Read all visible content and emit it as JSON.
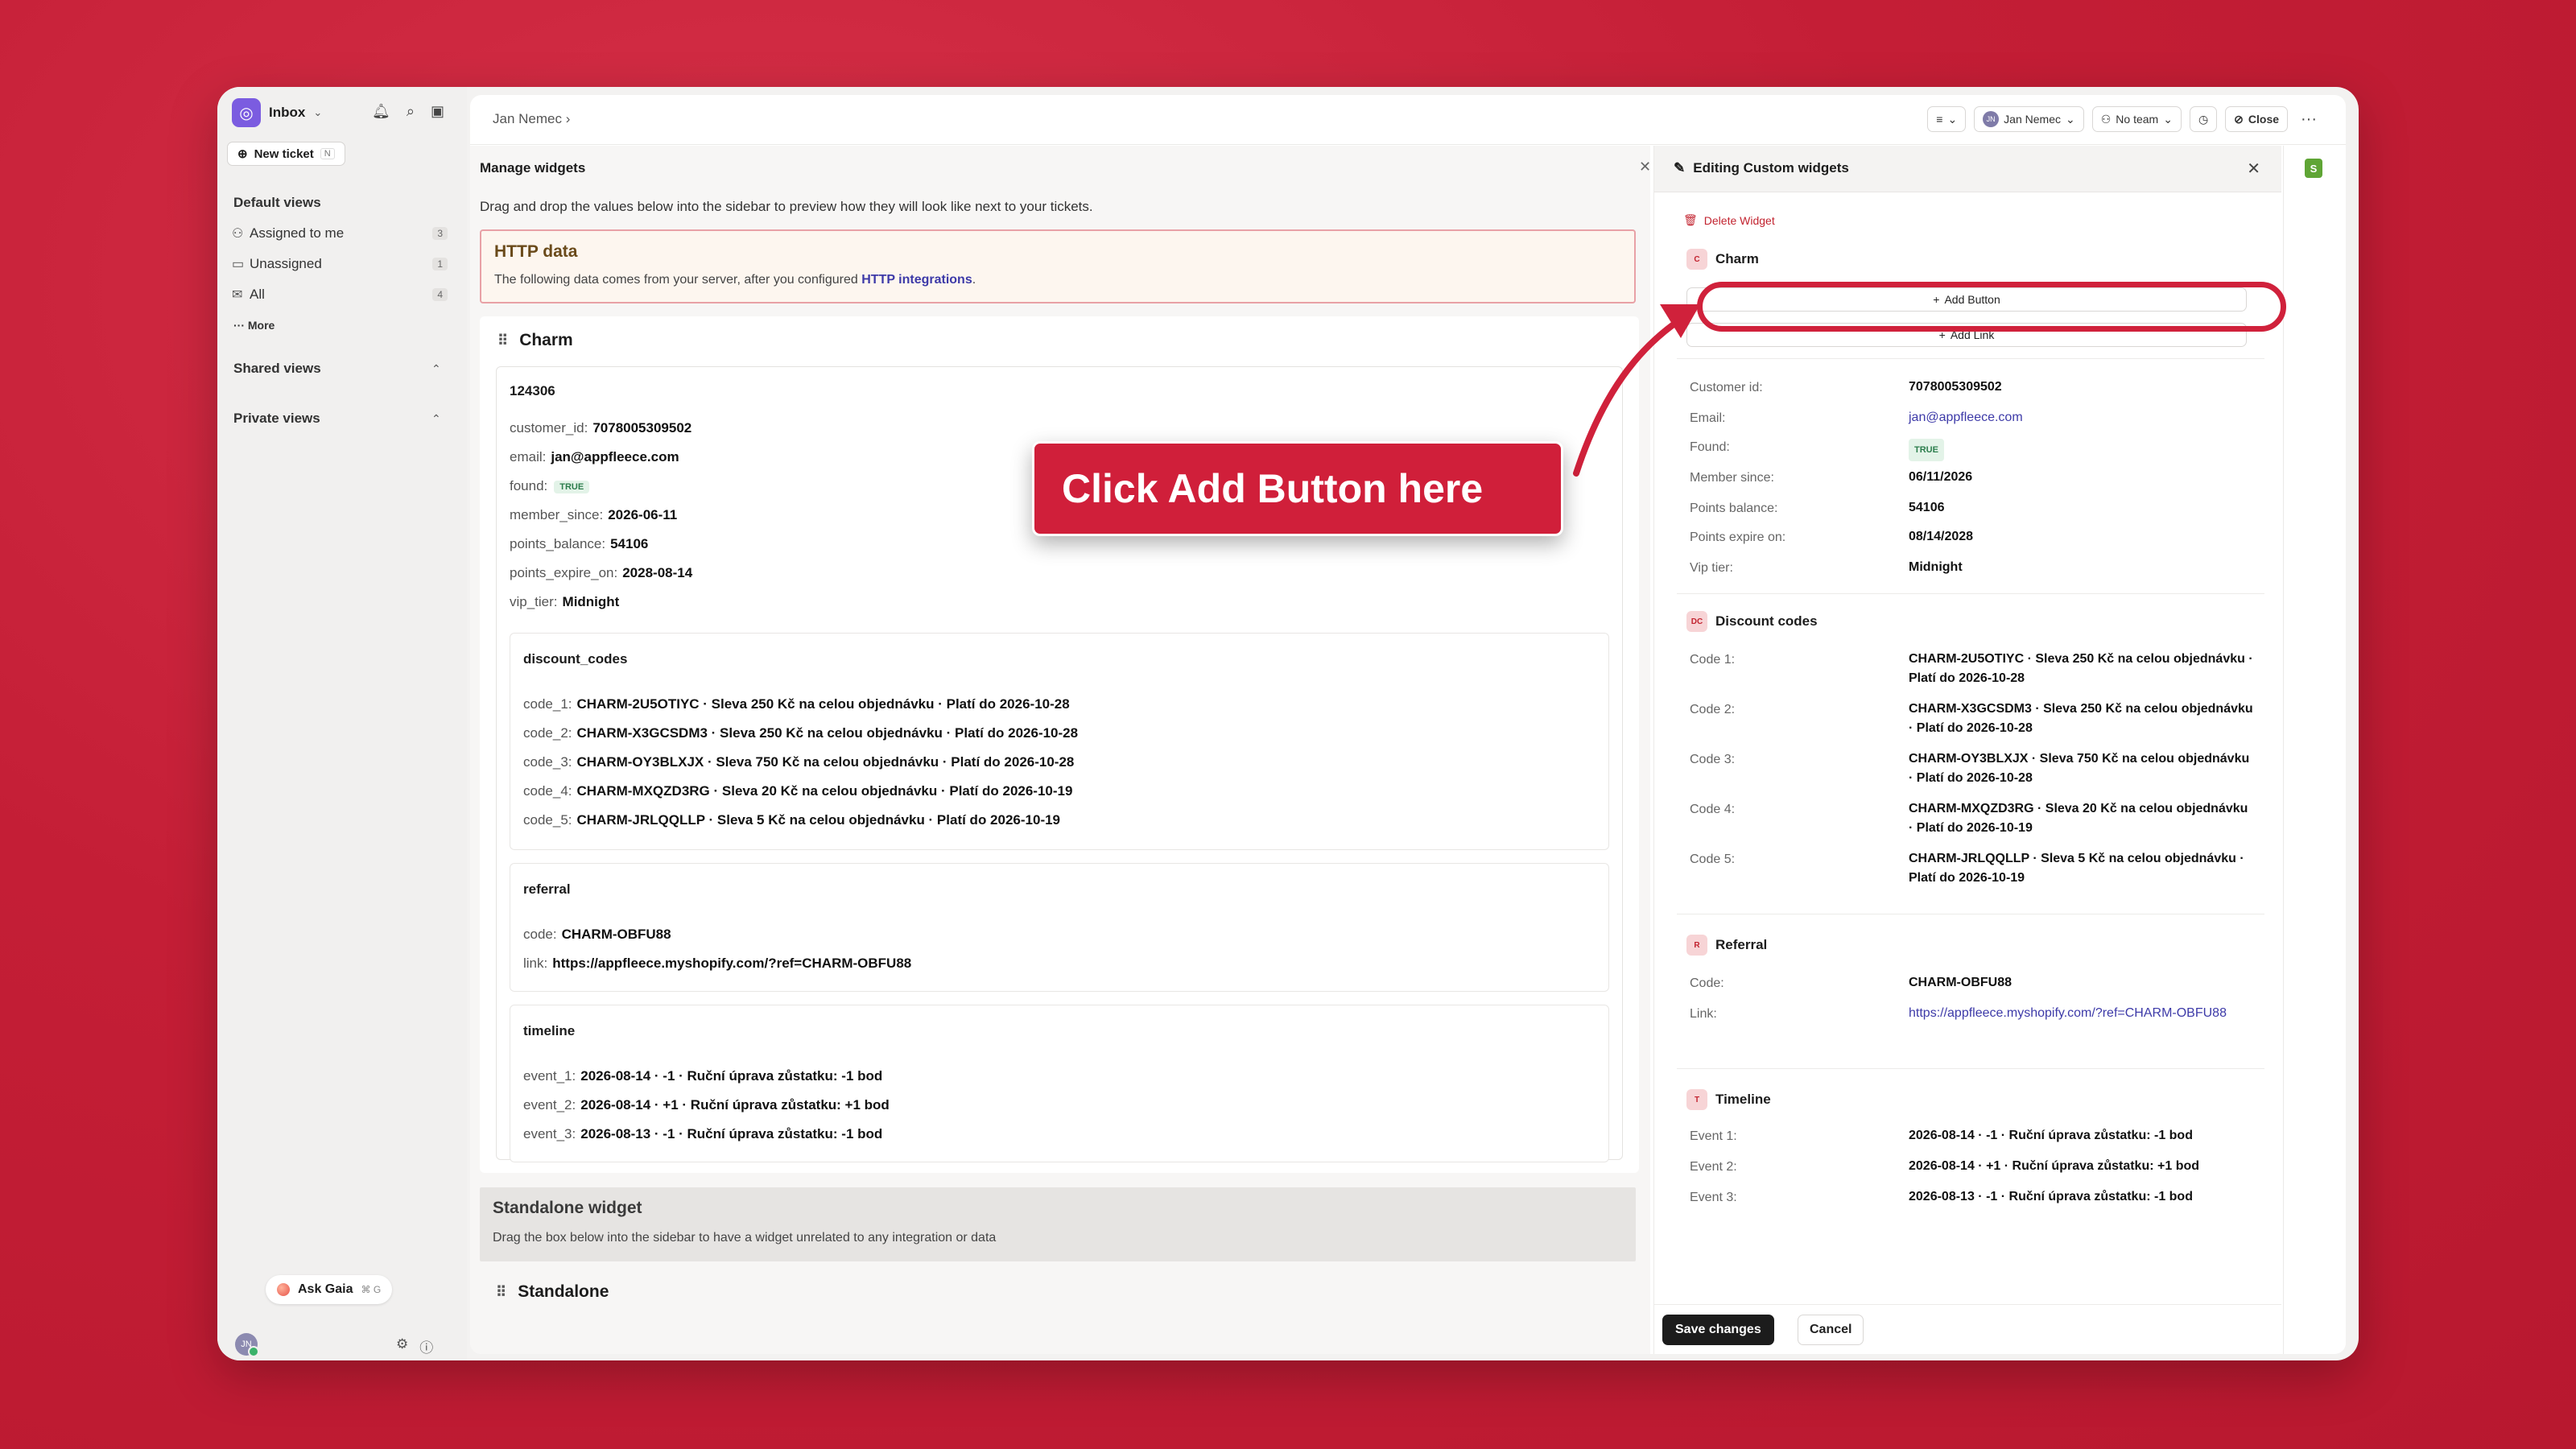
{
  "sidebar": {
    "title": "Inbox",
    "new_ticket": "New ticket",
    "new_ticket_kbd": "N",
    "default_views": "Default views",
    "items": [
      {
        "label": "Assigned to me",
        "count": "3"
      },
      {
        "label": "Unassigned",
        "count": "1"
      },
      {
        "label": "All",
        "count": "4"
      }
    ],
    "more": "More",
    "shared_views": "Shared views",
    "private_views": "Private views",
    "ask_gaia": "Ask Gaia",
    "ask_gaia_kbd": "⌘ G",
    "avatar_initials": "JN"
  },
  "topbar": {
    "breadcrumb": "Jan Nemec",
    "assignee": "Jan Nemec",
    "assignee_initials": "JN",
    "team": "No team",
    "close": "Close"
  },
  "manage": {
    "title": "Manage widgets",
    "description": "Drag and drop the values below into the sidebar to preview how they will look like next to your tickets.",
    "http_title": "HTTP data",
    "http_desc": "The following data comes from your server, after you configured",
    "http_link": "HTTP integrations",
    "http_dot": ".",
    "charm_title": "Charm",
    "charm_id": "124306",
    "fields": [
      {
        "k": "customer_id:",
        "v": "7078005309502"
      },
      {
        "k": "email:",
        "v": "jan@appfleece.com"
      },
      {
        "k": "found:",
        "v": "TRUE"
      },
      {
        "k": "member_since:",
        "v": "2026-06-11"
      },
      {
        "k": "points_balance:",
        "v": "54106"
      },
      {
        "k": "points_expire_on:",
        "v": "2028-08-14"
      },
      {
        "k": "vip_tier:",
        "v": "Midnight"
      }
    ],
    "discount_title": "discount_codes",
    "discount_codes": [
      {
        "k": "code_1:",
        "v": "CHARM-2U5OTIYC · Sleva 250 Kč na celou objednávku · Platí do 2026-10-28"
      },
      {
        "k": "code_2:",
        "v": "CHARM-X3GCSDM3 · Sleva 250 Kč na celou objednávku · Platí do 2026-10-28"
      },
      {
        "k": "code_3:",
        "v": "CHARM-OY3BLXJX · Sleva 750 Kč na celou objednávku · Platí do 2026-10-28"
      },
      {
        "k": "code_4:",
        "v": "CHARM-MXQZD3RG · Sleva 20 Kč na celou objednávku · Platí do 2026-10-19"
      },
      {
        "k": "code_5:",
        "v": "CHARM-JRLQQLLP · Sleva 5 Kč na celou objednávku · Platí do 2026-10-19"
      }
    ],
    "referral_title": "referral",
    "referral": [
      {
        "k": "code:",
        "v": "CHARM-OBFU88"
      },
      {
        "k": "link:",
        "v": "https://appfleece.myshopify.com/?ref=CHARM-OBFU88"
      }
    ],
    "timeline_title": "timeline",
    "timeline": [
      {
        "k": "event_1:",
        "v": "2026-08-14 · -1 · Ruční úprava zůstatku: -1 bod"
      },
      {
        "k": "event_2:",
        "v": "2026-08-14 · +1 · Ruční úprava zůstatku: +1 bod"
      },
      {
        "k": "event_3:",
        "v": "2026-08-13 · -1 · Ruční úprava zůstatku: -1 bod"
      }
    ],
    "standalone_title": "Standalone widget",
    "standalone_desc": "Drag the box below into the sidebar to have a widget unrelated to any integration or data",
    "standalone_head": "Standalone"
  },
  "edit": {
    "title": "Editing Custom widgets",
    "delete": "Delete Widget",
    "charm_title": "Charm",
    "charm_icon": "C",
    "add_button": "Add Button",
    "add_link": "Add Link",
    "fields": [
      {
        "k": "Customer id:",
        "v": "7078005309502"
      },
      {
        "k": "Email:",
        "v": "jan@appfleece.com"
      },
      {
        "k": "Found:",
        "v": "TRUE"
      },
      {
        "k": "Member since:",
        "v": "06/11/2026"
      },
      {
        "k": "Points balance:",
        "v": "54106"
      },
      {
        "k": "Points expire on:",
        "v": "08/14/2028"
      },
      {
        "k": "Vip tier:",
        "v": "Midnight"
      }
    ],
    "discount_title": "Discount codes",
    "discount_icon": "DC",
    "discount_codes": [
      {
        "k": "Code 1:",
        "v": "CHARM-2U5OTIYC · Sleva 250 Kč na celou objednávku · Platí do 2026-10-28"
      },
      {
        "k": "Code 2:",
        "v": "CHARM-X3GCSDM3 · Sleva 250 Kč na celou objednávku · Platí do 2026-10-28"
      },
      {
        "k": "Code 3:",
        "v": "CHARM-OY3BLXJX · Sleva 750 Kč na celou objednávku · Platí do 2026-10-28"
      },
      {
        "k": "Code 4:",
        "v": "CHARM-MXQZD3RG · Sleva 20 Kč na celou objednávku · Platí do 2026-10-19"
      },
      {
        "k": "Code 5:",
        "v": "CHARM-JRLQQLLP · Sleva 5 Kč na celou objednávku · Platí do 2026-10-19"
      }
    ],
    "referral_title": "Referral",
    "referral_icon": "R",
    "referral": [
      {
        "k": "Code:",
        "v": "CHARM-OBFU88"
      },
      {
        "k": "Link:",
        "v": "https://appfleece.myshopify.com/?ref=CHARM-OBFU88"
      }
    ],
    "timeline_title": "Timeline",
    "timeline_icon": "T",
    "timeline": [
      {
        "k": "Event 1:",
        "v": "2026-08-14 · -1 · Ruční úprava zůstatku: -1 bod"
      },
      {
        "k": "Event 2:",
        "v": "2026-08-14 · +1 · Ruční úprava zůstatku: +1 bod"
      },
      {
        "k": "Event 3:",
        "v": "2026-08-13 · -1 · Ruční úprava zůstatku: -1 bod"
      }
    ],
    "save": "Save changes",
    "cancel": "Cancel"
  },
  "callout": {
    "text": "Click Add Button here"
  },
  "colors": {
    "background": "#c41e36",
    "accent": "#d01f3a",
    "link": "#3d3aa8",
    "brand": "#7b5ce0"
  }
}
